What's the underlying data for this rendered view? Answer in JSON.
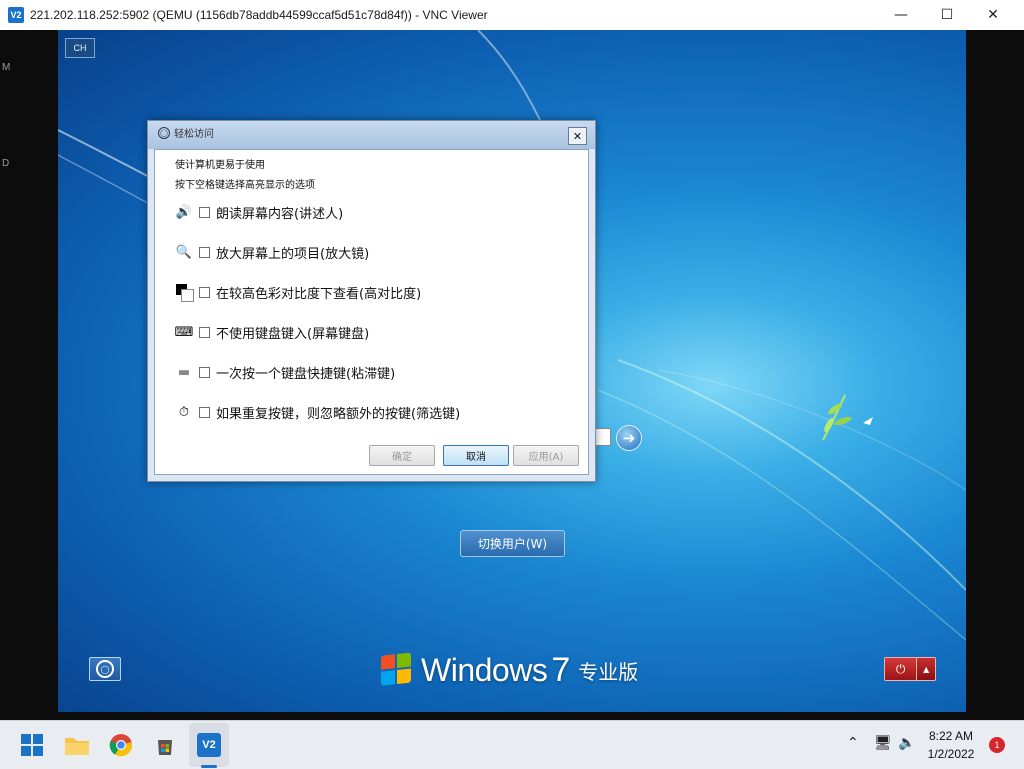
{
  "vnc": {
    "logo": "V2",
    "title": "221.202.118.252:5902 (QEMU (1156db78addb44599ccaf5d51c78d84f)) - VNC Viewer",
    "side_fragment_1": "M",
    "side_fragment_2": "D"
  },
  "remote": {
    "lang_badge": "CH",
    "switch_user_label": "切换用户(W)",
    "brand": {
      "name": "Windows",
      "version": "7",
      "edition": "专业版"
    }
  },
  "dialog": {
    "title": "轻松访问",
    "desc_line1": "使计算机更易于使用",
    "desc_line2": "按下空格键选择高亮显示的选项",
    "options": [
      {
        "label": "朗读屏幕内容(讲述人)",
        "icon": "narrator-icon",
        "checked": false
      },
      {
        "label": "放大屏幕上的项目(放大镜)",
        "icon": "magnifier-icon",
        "checked": false
      },
      {
        "label": "在较高色彩对比度下查看(高对比度)",
        "icon": "high-contrast-icon",
        "checked": false
      },
      {
        "label": "不使用键盘键入(屏幕键盘)",
        "icon": "onscreen-keyboard-icon",
        "checked": false
      },
      {
        "label": "一次按一个键盘快捷键(粘滞键)",
        "icon": "sticky-keys-icon",
        "checked": false
      },
      {
        "label": "如果重复按键，则忽略额外的按键(筛选键)",
        "icon": "filter-keys-icon",
        "checked": false
      }
    ],
    "buttons": {
      "ok": "确定",
      "cancel": "取消",
      "apply": "应用(A)"
    }
  },
  "taskbar": {
    "clock_time": "8:22 AM",
    "clock_date": "1/2/2022",
    "notification_count": "1"
  }
}
